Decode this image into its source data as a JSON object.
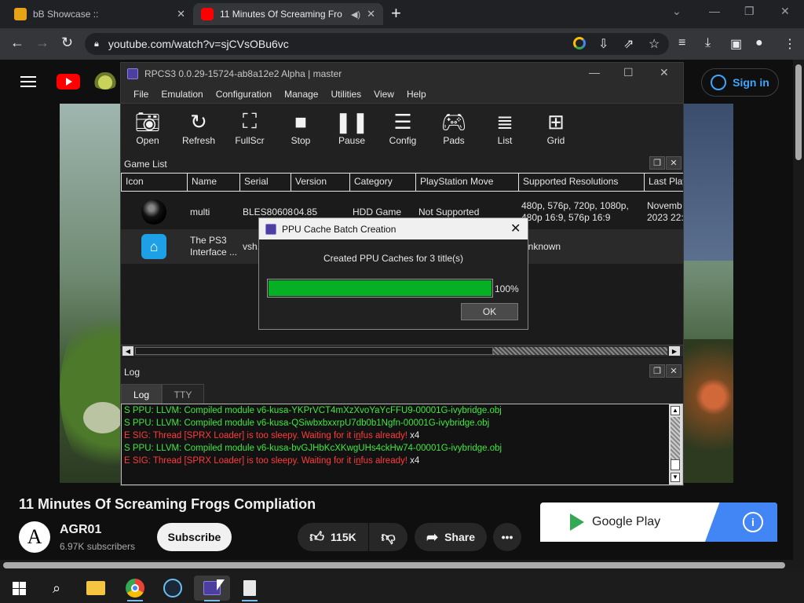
{
  "browser": {
    "tabs": [
      {
        "title": "bB Showcase ::",
        "close": "✕"
      },
      {
        "title": "11 Minutes Of Screaming Fro",
        "close": "✕"
      }
    ],
    "new_tab": "+",
    "url": "youtube.com/watch?v=sjCVsOBu6vc"
  },
  "youtube": {
    "signin": "Sign in",
    "video_title": "11 Minutes Of Screaming Frogs Compliation",
    "channel": {
      "avatar_letter": "A",
      "name": "AGR01",
      "subscribers": "6.97K subscribers"
    },
    "subscribe": "Subscribe",
    "likes": "115K",
    "share": "Share",
    "ad": {
      "brand": "Google Play",
      "info": "i"
    }
  },
  "rpcs3": {
    "title": "RPCS3 0.0.29-15724-ab8a12e2 Alpha | master",
    "menu": [
      "File",
      "Emulation",
      "Configuration",
      "Manage",
      "Utilities",
      "View",
      "Help"
    ],
    "toolbar": [
      {
        "label": "Open",
        "icon": "camera-icon"
      },
      {
        "label": "Refresh",
        "icon": "refresh-icon"
      },
      {
        "label": "FullScr",
        "icon": "fullscreen-icon"
      },
      {
        "label": "Stop",
        "icon": "stop-icon"
      },
      {
        "label": "Pause",
        "icon": "pause-icon"
      },
      {
        "label": "Config",
        "icon": "sliders-icon"
      },
      {
        "label": "Pads",
        "icon": "gamepad-icon"
      },
      {
        "label": "List",
        "icon": "list-icon"
      },
      {
        "label": "Grid",
        "icon": "grid-icon"
      }
    ],
    "game_list": {
      "label": "Game List",
      "columns": [
        "Icon",
        "Name",
        "Serial",
        "Version",
        "Category",
        "PlayStation Move",
        "Supported Resolutions",
        "Last Play"
      ],
      "rows": [
        {
          "name": "multi",
          "serial": "BLES80608",
          "version": "04.85",
          "category": "HDD Game",
          "move": "Not Supported",
          "resolutions_1": "480p, 576p, 720p, 1080p,",
          "resolutions_2": "480p 16:9, 576p 16:9",
          "last_1": "Novemb",
          "last_2": "2023 22:1"
        },
        {
          "name_1": "The PS3",
          "name_2": "Interface ...",
          "serial": "vsh.",
          "resolutions": "Unknown"
        }
      ]
    },
    "log": {
      "label": "Log",
      "tabs": [
        "Log",
        "TTY"
      ],
      "lines": [
        {
          "text": "S PPU: LLVM: Compiled module v6-kusa-YKPrVCT4mXzXvoYaYcFFU9-00001G-ivybridge.obj",
          "count": "",
          "color": "#3ee83e"
        },
        {
          "text": "S PPU: LLVM: Compiled module v6-kusa-QSiwbxbxxrpU7db0b1Ngfn-00001G-ivybridge.obj",
          "count": "",
          "color": "#3ee83e"
        },
        {
          "text": "E SIG: Thread [SPRX Loader] is too sleepy. Waiting for it in̲fus already!",
          "count": "x4",
          "color": "#ff3b3b"
        },
        {
          "text": "S PPU: LLVM: Compiled module v6-kusa-bvGJHbKcXKwgUHs4ckHw74-00001G-ivybridge.obj",
          "count": "",
          "color": "#3ee83e"
        },
        {
          "text": "E SIG: Thread [SPRX Loader] is too sleepy. Waiting for it in̲fus already!",
          "count": "x4",
          "color": "#ff3b3b"
        }
      ]
    }
  },
  "dialog": {
    "title": "PPU Cache Batch Creation",
    "message": "Created PPU Caches for 3 title(s)",
    "progress": 100,
    "progress_label": "100%",
    "ok": "OK"
  },
  "colors": {
    "progress_fill": "#06b025",
    "accent_blue": "#3ea6ff",
    "youtube_red": "#ff0000"
  }
}
